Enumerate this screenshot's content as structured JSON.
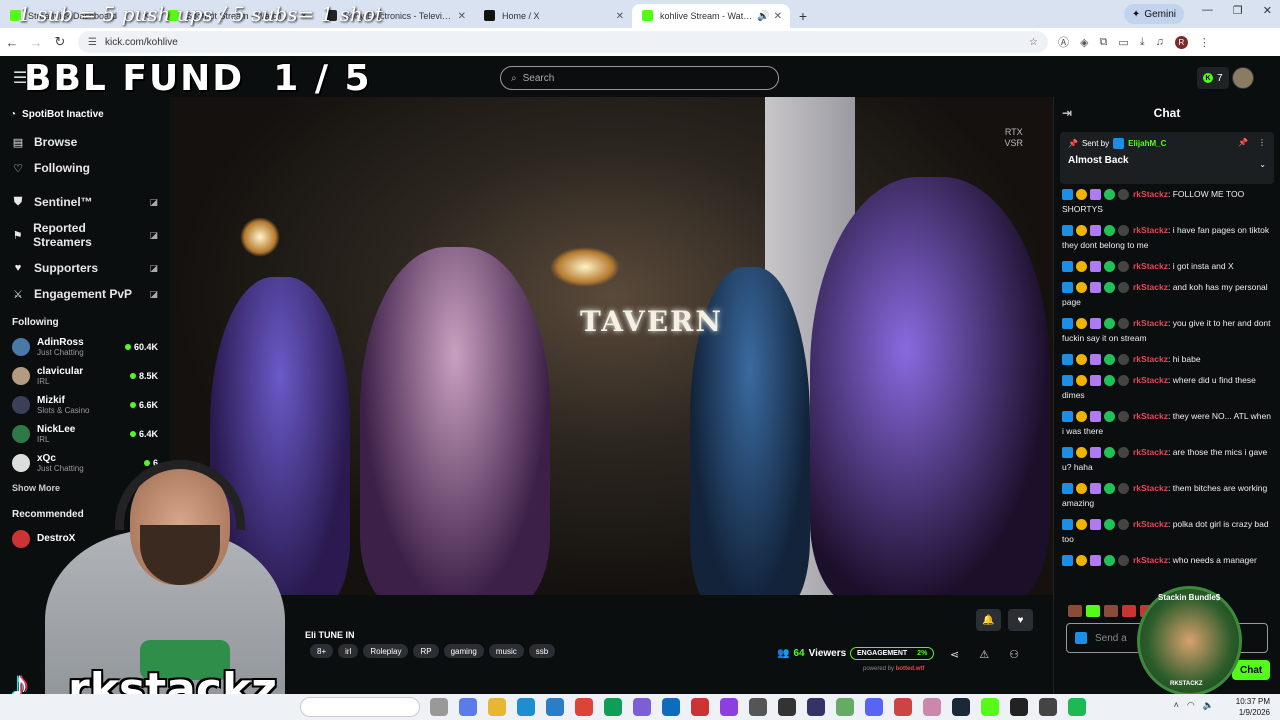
{
  "overlay": {
    "ticker": "1 sub = 5 push ups / 5 subs= 1 shot",
    "fund_title": "BBL FUND  1 / 5",
    "webcam_name": "rkstackz",
    "tiktok_glyph": "♪"
  },
  "browser": {
    "tabs": [
      {
        "label": "Stream  ick Dashboard",
        "active": false
      },
      {
        "label": "Spotbot Stream - Watch Live",
        "active": false
      },
      {
        "label": "Sony Electronics - Televisions, Au",
        "active": false
      },
      {
        "label": "Home / X",
        "active": false
      },
      {
        "label": "kohlive Stream - Watch Live",
        "active": true
      }
    ],
    "new_tab": "+",
    "gemini_label": "Gemini",
    "url": "kick.com/kohlive",
    "profile_initial": "R"
  },
  "header": {
    "search_placeholder": "Search",
    "points": "7"
  },
  "sidebar": {
    "spotibot": "SpotiBot Inactive",
    "nav": [
      {
        "label": "Browse",
        "icon": "browse-icon"
      },
      {
        "label": "Following",
        "icon": "heart-icon"
      }
    ],
    "tools": [
      {
        "label": "Sentinel™",
        "icon": "shield-icon"
      },
      {
        "label": "Reported Streamers",
        "icon": "flag-icon"
      },
      {
        "label": "Supporters",
        "icon": "heart-icon"
      },
      {
        "label": "Engagement PvP",
        "icon": "swords-icon"
      }
    ],
    "following_title": "Following",
    "following": [
      {
        "name": "AdinRoss",
        "category": "Just Chatting",
        "viewers": "60.4K"
      },
      {
        "name": "clavicular",
        "category": "IRL",
        "viewers": "8.5K"
      },
      {
        "name": "Mizkif",
        "category": "Slots & Casino",
        "viewers": "6.6K"
      },
      {
        "name": "NickLee",
        "category": "IRL",
        "viewers": "6.4K"
      },
      {
        "name": "xQc",
        "category": "Just Chatting",
        "viewers": "6"
      }
    ],
    "show_more": "Show More",
    "recommended_title": "Recommended",
    "recommended": [
      {
        "name": "DestroX"
      }
    ]
  },
  "video": {
    "sign": "TAVERN",
    "rtx": "RTX",
    "vsr": "VSR"
  },
  "stream_info": {
    "title": "Eli TUNE IN",
    "tags": [
      "8+",
      "irl",
      "Roleplay",
      "RP",
      "gaming",
      "music",
      "ssb"
    ],
    "viewers_count": "64",
    "viewers_label": "Viewers",
    "engagement_label": "ENGAGEMENT",
    "engagement_pct": "2%",
    "powered_by": "powered by",
    "powered_brand": "botted.wtf"
  },
  "chat": {
    "title": "Chat",
    "pinned_by_label": "Sent by",
    "pinned_user": "ElijahM_C",
    "pinned_message": "Almost Back",
    "messages": [
      {
        "user": "rkStackz",
        "text": "FOLLOW ME TOO SHORTYS"
      },
      {
        "user": "rkStackz",
        "text": "i have fan pages on tiktok they dont belong to me"
      },
      {
        "user": "rkStackz",
        "text": "i got insta and X"
      },
      {
        "user": "rkStackz",
        "text": "and koh has my personal page"
      },
      {
        "user": "rkStackz",
        "text": "you give it to her and dont fuckin say it on stream"
      },
      {
        "user": "rkStackz",
        "text": "hi babe"
      },
      {
        "user": "rkStackz",
        "text": "where did u find these dimes"
      },
      {
        "user": "rkStackz",
        "text": "they were NO... ATL when i was there"
      },
      {
        "user": "rkStackz",
        "text": "are those the mics i gave u? haha"
      },
      {
        "user": "rkStackz",
        "text": "them bitches are working amazing"
      },
      {
        "user": "rkStackz",
        "text": "polka dot girl is crazy bad too"
      },
      {
        "user": "rkStackz",
        "text": "who needs a manager"
      }
    ],
    "input_placeholder": "Send a",
    "send_label": "Chat",
    "sticker_top": "Stackin Bundle$",
    "sticker_bottom": "RKSTACKZ"
  },
  "taskbar": {
    "time": "10:37 PM",
    "date": "1/9/2026"
  },
  "colors": {
    "kick_green": "#53fc18",
    "chat_user": "#e8455b",
    "background": "#0b0e0f"
  }
}
